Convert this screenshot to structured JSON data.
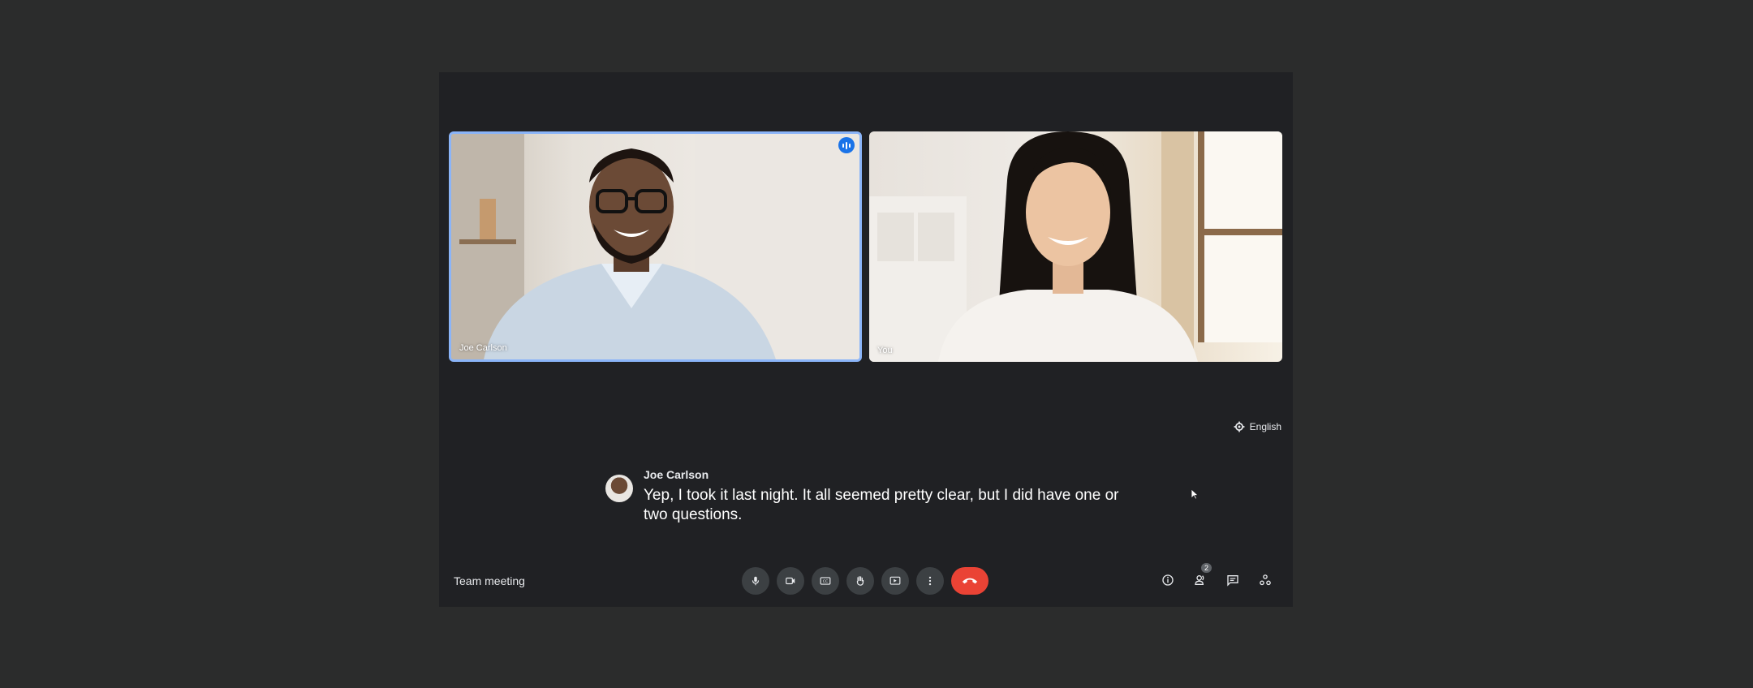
{
  "participants": [
    {
      "name": "Joe Carlson",
      "speaking": true
    },
    {
      "name": "You",
      "speaking": false
    }
  ],
  "captions": {
    "language": "English",
    "speaker": "Joe Carlson",
    "text": "Yep, I took it last night. It all seemed pretty clear, but I did have one or two questions."
  },
  "meeting": {
    "title": "Team meeting"
  },
  "controls": [
    "mic-icon",
    "camera-icon",
    "captions-icon",
    "raise-hand-icon",
    "present-icon",
    "more-options-icon",
    "end-call-icon"
  ],
  "side_controls": {
    "people_count": "2"
  },
  "colors": {
    "active_border": "#8ab4f8",
    "end_call": "#ea4335",
    "speaking_indicator": "#1a73e8"
  }
}
